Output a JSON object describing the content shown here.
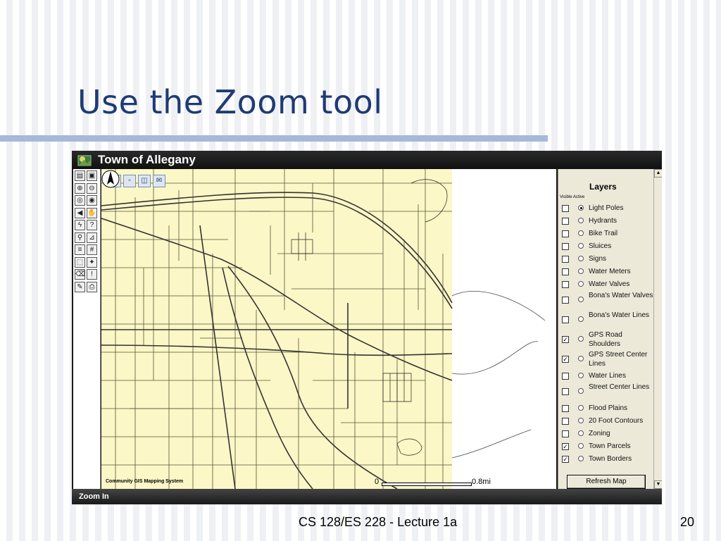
{
  "slide": {
    "title": "Use the Zoom tool",
    "footer": "CS 128/ES 228 - Lecture 1a",
    "page_number": "20"
  },
  "app": {
    "title": "Town of Allegany",
    "status": "Zoom In",
    "credit": "Community GIS Mapping System",
    "scale_start": "0",
    "scale_end": "0.8mi"
  },
  "toolbar": {
    "tools": [
      {
        "name": "legend-toggle-icon",
        "glyph": "▤"
      },
      {
        "name": "overview-map-icon",
        "glyph": "▣"
      },
      {
        "name": "zoom-in-icon",
        "glyph": "⊕"
      },
      {
        "name": "zoom-out-icon",
        "glyph": "⊖"
      },
      {
        "name": "zoom-full-icon",
        "glyph": "◎"
      },
      {
        "name": "zoom-active-layer-icon",
        "glyph": "◉"
      },
      {
        "name": "back-extent-icon",
        "glyph": "◀"
      },
      {
        "name": "pan-hand-icon",
        "glyph": "✋"
      },
      {
        "name": "hyperlink-icon",
        "glyph": "ϟ"
      },
      {
        "name": "identify-icon",
        "glyph": "?"
      },
      {
        "name": "find-binoculars-icon",
        "glyph": "⚲"
      },
      {
        "name": "measure-icon",
        "glyph": "⊿"
      },
      {
        "name": "query-icon",
        "glyph": "≡"
      },
      {
        "name": "select-grid-icon",
        "glyph": "#"
      },
      {
        "name": "select-rectangle-icon",
        "glyph": "⬚"
      },
      {
        "name": "select-features-icon",
        "glyph": "✦"
      },
      {
        "name": "clear-selection-icon",
        "glyph": "⌫"
      },
      {
        "name": "info-icon",
        "glyph": "!"
      },
      {
        "name": "buffer-icon",
        "glyph": "✎"
      },
      {
        "name": "print-icon",
        "glyph": "⎙"
      }
    ]
  },
  "mini_toolbar": [
    {
      "name": "save-icon",
      "glyph": "▪"
    },
    {
      "name": "export-icon",
      "glyph": "▫"
    },
    {
      "name": "print-preview-icon",
      "glyph": "◫"
    },
    {
      "name": "email-icon",
      "glyph": "✉"
    }
  ],
  "layers": {
    "title": "Layers",
    "columns": "Visible Active",
    "refresh_label": "Refresh Map",
    "items": [
      {
        "label": "Light Poles",
        "visible": false,
        "active": true
      },
      {
        "label": "Hydrants",
        "visible": false,
        "active": false
      },
      {
        "label": "Bike Trail",
        "visible": false,
        "active": false
      },
      {
        "label": "Sluices",
        "visible": false,
        "active": false
      },
      {
        "label": "Signs",
        "visible": false,
        "active": false
      },
      {
        "label": "Water Meters",
        "visible": false,
        "active": false
      },
      {
        "label": "Water Valves",
        "visible": false,
        "active": false
      },
      {
        "label": "Bona's Water Valves",
        "visible": false,
        "active": false
      },
      {
        "label": "Bona's Water Lines",
        "visible": false,
        "active": false
      },
      {
        "label": "GPS Road Shoulders",
        "visible": true,
        "active": false
      },
      {
        "label": "GPS Street Center Lines",
        "visible": true,
        "active": false
      },
      {
        "label": "Water Lines",
        "visible": false,
        "active": false
      },
      {
        "label": "Street Center Lines",
        "visible": false,
        "active": false
      },
      {
        "label": "Flood Plains",
        "visible": false,
        "active": false
      },
      {
        "label": "20 Foot Contours",
        "visible": false,
        "active": false
      },
      {
        "label": "Zoning",
        "visible": false,
        "active": false
      },
      {
        "label": "Town Parcels",
        "visible": true,
        "active": false
      },
      {
        "label": "Town Borders",
        "visible": true,
        "active": false
      }
    ]
  },
  "colors": {
    "title_blue": "#1f3b73",
    "map_parcel_fill": "#fbf7c6",
    "map_line": "#4a4a2a"
  }
}
